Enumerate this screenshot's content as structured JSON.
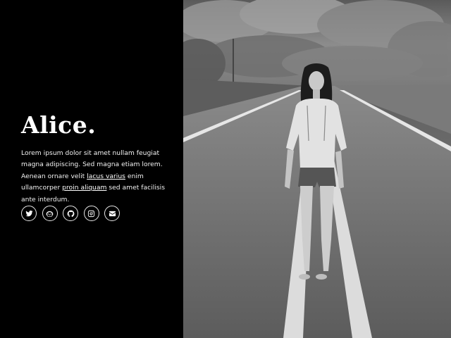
{
  "profile": {
    "name": "Alice.",
    "bio_part1": "Lorem ipsum dolor sit amet nullam feugiat magna adipiscing. Sed magna etiam lorem. Aenean ornare velit ",
    "bio_link1": "lacus varius",
    "bio_part2": " enim ullamcorper ",
    "bio_link2": "proin aliquam",
    "bio_part3": " sed amet facilisis ante interdum."
  },
  "socials": [
    {
      "name": "twitter",
      "icon": "twitter-icon"
    },
    {
      "name": "dribbble",
      "icon": "dribbble-icon"
    },
    {
      "name": "github",
      "icon": "github-icon"
    },
    {
      "name": "instagram",
      "icon": "instagram-icon"
    },
    {
      "name": "email",
      "icon": "envelope-icon"
    }
  ],
  "colors": {
    "sidebar_bg": "#000000",
    "text": "#ffffff"
  }
}
